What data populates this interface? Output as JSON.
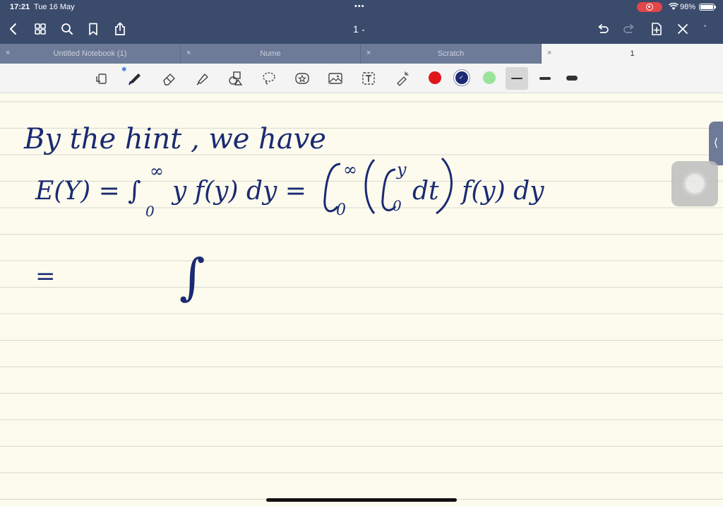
{
  "status_bar": {
    "time": "17:21",
    "date": "Tue 16 May",
    "battery_percent": "98%",
    "battery_level": 0.98,
    "dots": "•••"
  },
  "nav_bar": {
    "page_number": "1",
    "icons": [
      "back-icon",
      "grid-icon",
      "search-icon",
      "bookmark-icon",
      "share-icon",
      "undo-icon",
      "redo-icon",
      "add-page-icon",
      "close-icon",
      "more-icon"
    ]
  },
  "tabs": [
    {
      "label": "Untitled Notebook (1)",
      "active": false
    },
    {
      "label": "Nume",
      "active": false
    },
    {
      "label": "Scratch",
      "active": false
    },
    {
      "label": "1",
      "active": true
    }
  ],
  "tab_close_glyph": "×",
  "toolbar": {
    "tools": [
      "lasso-select-icon",
      "pen-icon",
      "eraser-icon",
      "highlighter-icon",
      "shapes-icon",
      "lasso-icon",
      "sticker-icon",
      "image-icon",
      "text-icon",
      "laser-pointer-icon"
    ],
    "colors": [
      "#e0161b",
      "#1a2a73",
      "#9be39b"
    ],
    "selected_color": "#1a2a73",
    "stroke_widths": [
      "thin",
      "medium",
      "thick"
    ],
    "selected_stroke": "thin"
  },
  "notes": {
    "line1": "By the hint , we have",
    "line2_lhs": "E(Y) = ∫",
    "line2_sup": "∞",
    "line2_sub": "0",
    "line2_mid": "y f(y) dy =",
    "line2_int2_sup": "∞",
    "line2_int2_sub": "0",
    "line2_inner_sup": "y",
    "line2_inner_sub": "0",
    "line2_inner": "dt",
    "line2_tail": "f(y) dy",
    "line3_eq": "=",
    "line3_int": "∫"
  },
  "colors": {
    "chrome": "#3b4b6c",
    "tab_bar": "#6e7b98",
    "paper": "#fcfbed",
    "ink": "#1a2a73"
  }
}
